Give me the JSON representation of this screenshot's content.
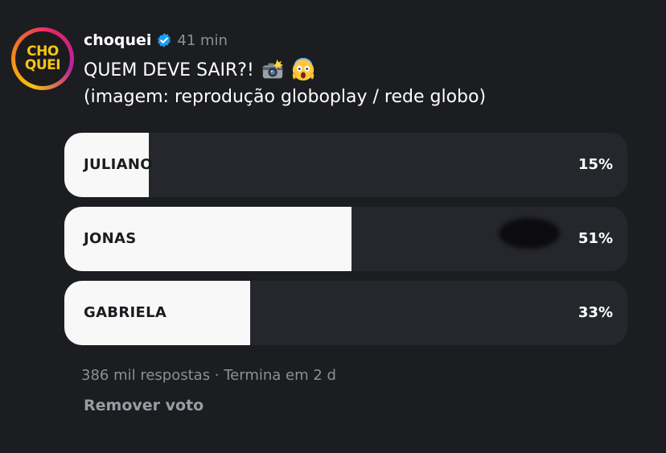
{
  "post": {
    "username": "choquei",
    "time": "41 min",
    "text_line1": "QUEM DEVE SAIR?!",
    "text_line2": "(imagem: reprodução globoplay / rede globo)",
    "emojis": [
      "camera-flash-icon",
      "screaming-face-icon"
    ]
  },
  "avatar": {
    "logo_line1": "CHO",
    "logo_line2": "QUEI"
  },
  "poll": {
    "options": [
      {
        "label": "JULIANO",
        "percent_text": "15%",
        "percent": 15
      },
      {
        "label": "JONAS",
        "percent_text": "51%",
        "percent": 51
      },
      {
        "label": "GABRIELA",
        "percent_text": "33%",
        "percent": 33
      }
    ],
    "meta": "386 mil respostas · Termina em 2 d",
    "remove_vote": "Remover voto"
  },
  "colors": {
    "background": "#1c1d21",
    "poll_track": "#25272c",
    "poll_fill": "#f8f8f8",
    "verified": "#1d9bf0",
    "logo": "#f5c518",
    "muted_text": "#8d8f95"
  }
}
